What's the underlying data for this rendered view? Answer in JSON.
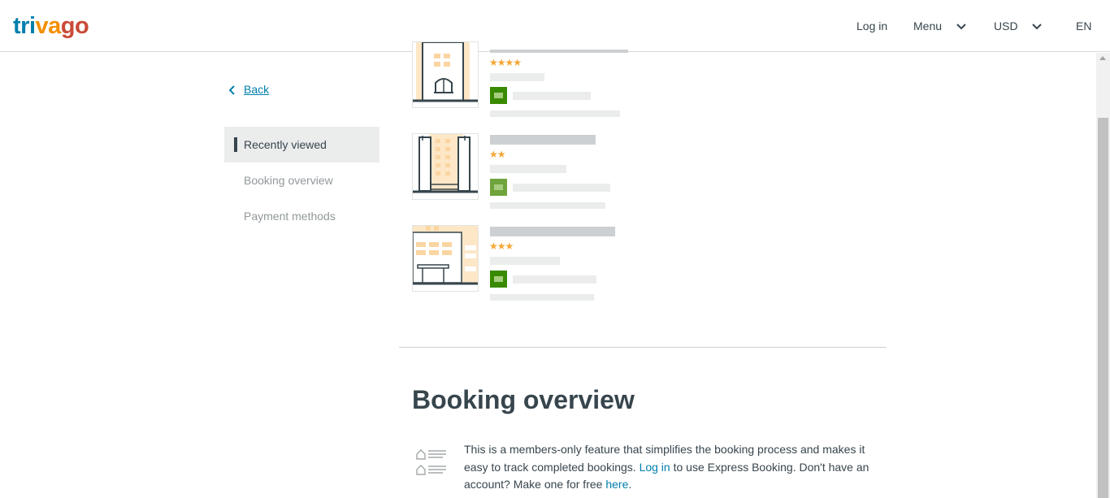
{
  "header": {
    "logo": {
      "part1": "tri",
      "part2": "va",
      "part3": "go"
    },
    "login": "Log in",
    "menu": "Menu",
    "currency": "USD",
    "language": "EN"
  },
  "sidebar": {
    "back": "Back",
    "items": [
      {
        "label": "Recently viewed",
        "active": true
      },
      {
        "label": "Booking overview",
        "active": false
      },
      {
        "label": "Payment methods",
        "active": false
      }
    ]
  },
  "hotels": [
    {
      "stars": "★★★★"
    },
    {
      "stars": "★★"
    },
    {
      "stars": "★★★"
    }
  ],
  "booking": {
    "title": "Booking overview",
    "text_before_login": "This is a members-only feature that simplifies the booking process and makes it easy to track completed bookings. ",
    "login_link": "Log in",
    "text_middle": " to use Express Booking. Don't have an account? Make one for free ",
    "here_link": "here",
    "text_end": "."
  },
  "colors": {
    "brand_blue": "#007fad",
    "brand_orange": "#f48f00",
    "brand_red": "#c94a38",
    "text": "#37454d",
    "star": "#f5a733",
    "deal_green": "#3a8a00"
  }
}
